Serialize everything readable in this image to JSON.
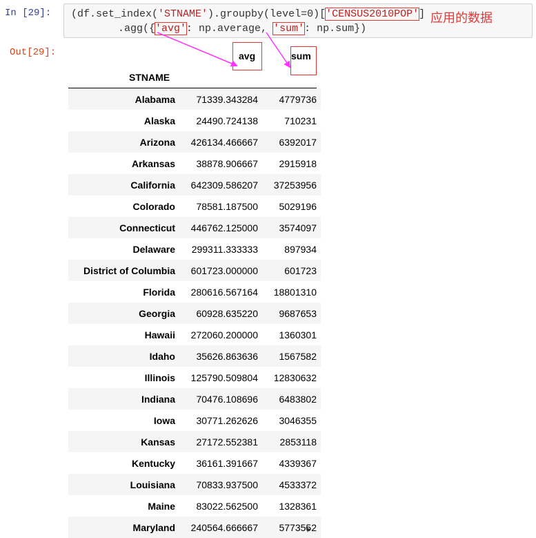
{
  "notebook": {
    "in_prompt": "In  [29]:",
    "out_prompt": "Out[29]:",
    "code": {
      "line1_prefix": "(df.set_index(",
      "line1_stname": "'STNAME'",
      "line1_mid": ").groupby(level=0)[",
      "line1_census": "'CENSUS2010POP'",
      "line1_suffix": "]",
      "line2_prefix": "    .agg({",
      "line2_avg": "'avg'",
      "line2_mid": ": np.average, ",
      "line2_sum": "'sum'",
      "line2_suffix": ": np.sum})"
    },
    "annotation": "应用的数据",
    "accent_color": "#e53935",
    "arrow_color": "#ff33ff"
  },
  "dataframe": {
    "index_name": "STNAME",
    "columns": [
      "avg",
      "sum"
    ],
    "rows": [
      {
        "state": "Alabama",
        "avg": "71339.343284",
        "sum": "4779736"
      },
      {
        "state": "Alaska",
        "avg": "24490.724138",
        "sum": "710231"
      },
      {
        "state": "Arizona",
        "avg": "426134.466667",
        "sum": "6392017"
      },
      {
        "state": "Arkansas",
        "avg": "38878.906667",
        "sum": "2915918"
      },
      {
        "state": "California",
        "avg": "642309.586207",
        "sum": "37253956"
      },
      {
        "state": "Colorado",
        "avg": "78581.187500",
        "sum": "5029196"
      },
      {
        "state": "Connecticut",
        "avg": "446762.125000",
        "sum": "3574097"
      },
      {
        "state": "Delaware",
        "avg": "299311.333333",
        "sum": "897934"
      },
      {
        "state": "District of Columbia",
        "avg": "601723.000000",
        "sum": "601723"
      },
      {
        "state": "Florida",
        "avg": "280616.567164",
        "sum": "18801310"
      },
      {
        "state": "Georgia",
        "avg": "60928.635220",
        "sum": "9687653"
      },
      {
        "state": "Hawaii",
        "avg": "272060.200000",
        "sum": "1360301"
      },
      {
        "state": "Idaho",
        "avg": "35626.863636",
        "sum": "1567582"
      },
      {
        "state": "Illinois",
        "avg": "125790.509804",
        "sum": "12830632"
      },
      {
        "state": "Indiana",
        "avg": "70476.108696",
        "sum": "6483802"
      },
      {
        "state": "Iowa",
        "avg": "30771.262626",
        "sum": "3046355"
      },
      {
        "state": "Kansas",
        "avg": "27172.552381",
        "sum": "2853118"
      },
      {
        "state": "Kentucky",
        "avg": "36161.391667",
        "sum": "4339367"
      },
      {
        "state": "Louisiana",
        "avg": "70833.937500",
        "sum": "4533372"
      },
      {
        "state": "Maine",
        "avg": "83022.562500",
        "sum": "1328361"
      },
      {
        "state": "Maryland",
        "avg": "240564.666667",
        "sum": "5773552"
      }
    ]
  }
}
